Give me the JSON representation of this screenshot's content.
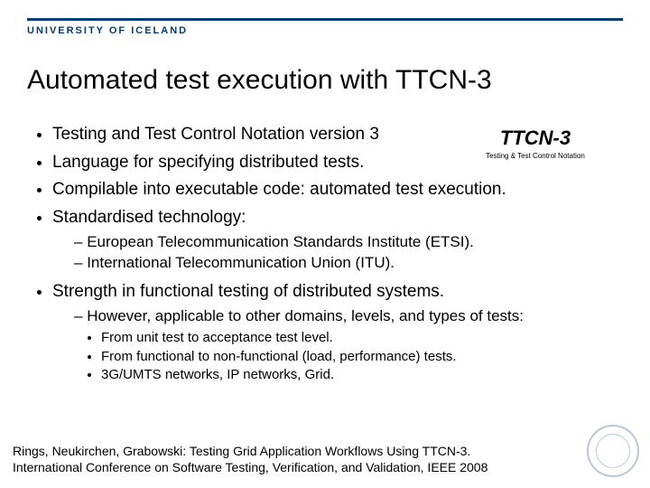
{
  "header": {
    "brand": "UNIVERSITY OF ICELAND"
  },
  "title": "Automated test execution with TTCN-3",
  "logo": {
    "wordmark": "TTCN-3",
    "tagline": "Testing & Test Control Notation"
  },
  "bullets": {
    "b1": "Testing and Test Control Notation version 3",
    "b2": "Language for specifying distributed tests.",
    "b3": "Compilable into executable code: automated test execution.",
    "b4": "Standardised technology:",
    "b4_sub": {
      "s1": "European Telecommunication Standards Institute (ETSI).",
      "s2": "International Telecommunication Union (ITU)."
    },
    "b5": "Strength in functional testing of distributed systems.",
    "b5_sub": {
      "s1": "However, applicable to other domains, levels, and types of tests:",
      "s1_sub": {
        "t1": "From unit test to acceptance test level.",
        "t2": "From functional to non-functional (load, performance) tests.",
        "t3": "3G/UMTS networks, IP networks, Grid."
      }
    }
  },
  "footer": {
    "line1": "Rings, Neukirchen, Grabowski: Testing Grid Application Workflows Using TTCN-3.",
    "line2": "International Conference on Software Testing, Verification, and Validation, IEEE 2008"
  }
}
